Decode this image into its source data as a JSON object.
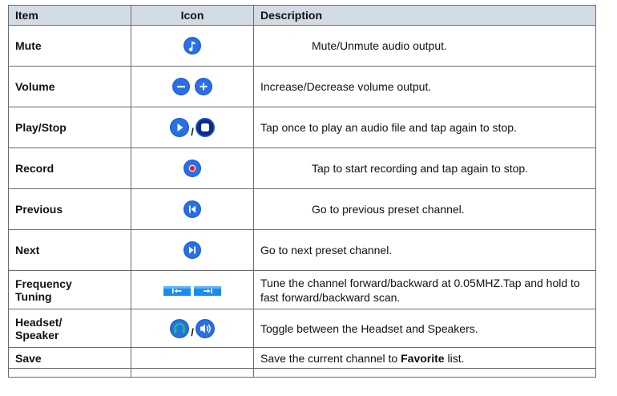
{
  "header": {
    "item": "Item",
    "icon": "Icon",
    "description": "Description"
  },
  "rows": [
    {
      "item": "Mute",
      "description": "Mute/Unmute audio output.",
      "icons": [
        "music-note-icon"
      ]
    },
    {
      "item": "Volume",
      "description": "Increase/Decrease volume output.",
      "icons": [
        "minus-icon",
        "plus-icon"
      ]
    },
    {
      "item": "Play/Stop",
      "separator": "/",
      "description": "Tap once to play an audio file and tap again to stop.",
      "icons": [
        "play-icon",
        "stop-icon"
      ]
    },
    {
      "item": "Record",
      "description": "Tap to start recording and tap again to stop.",
      "icons": [
        "record-icon"
      ]
    },
    {
      "item": "Previous",
      "description": "Go to previous preset channel.",
      "icons": [
        "previous-icon"
      ]
    },
    {
      "item": "Next",
      "description": "Go to next preset channel.",
      "icons": [
        "next-icon"
      ]
    },
    {
      "item": "Frequency Tuning",
      "item_line1": "Frequency",
      "item_line2": "Tuning",
      "description": "Tune the channel forward/backward at 0.05MHZ.Tap and hold to fast forward/backward scan.",
      "icons": [
        "tune-backward-icon",
        "tune-forward-icon"
      ]
    },
    {
      "item": "Headset/ Speaker",
      "item_line1": "Headset/",
      "item_line2": "Speaker",
      "separator": "/",
      "description": "Toggle between the Headset and Speakers.",
      "icons": [
        "headset-icon",
        "speaker-icon"
      ]
    },
    {
      "item": "Save",
      "description_pre": "Save the current channel to ",
      "description_bold": "Favorite",
      "description_post": " list."
    }
  ],
  "colors": {
    "header_bg": "#d3dbe4",
    "border": "#6b6b6b",
    "icon_blue": "#1f5fd6",
    "record_red": "#e8202a"
  }
}
